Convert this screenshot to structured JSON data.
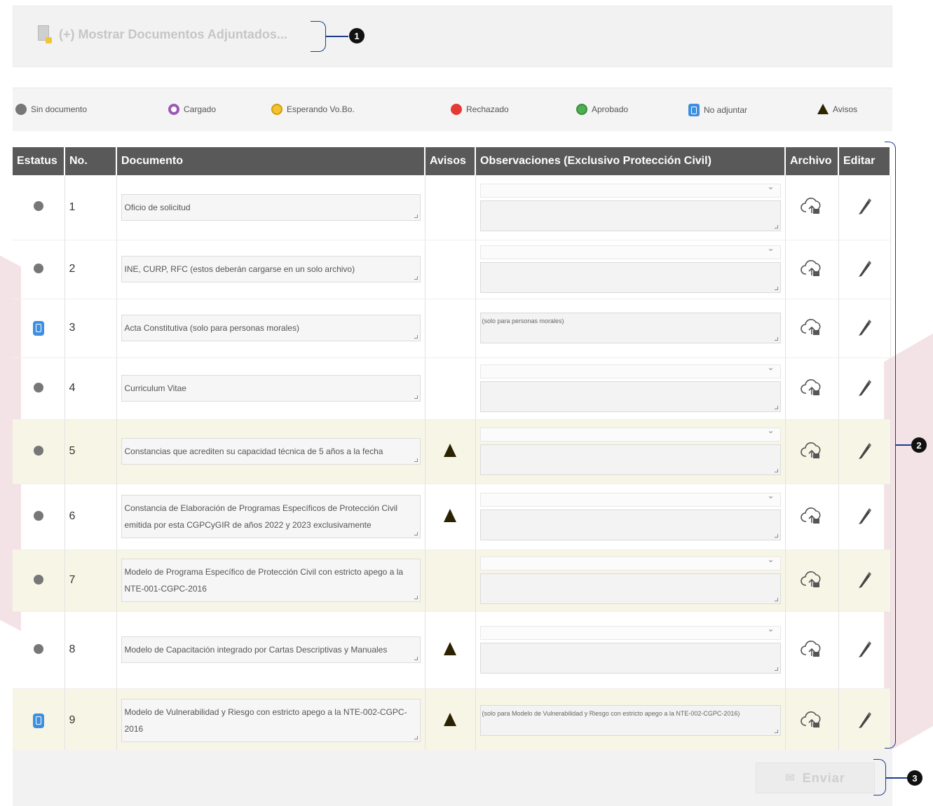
{
  "attachments": {
    "toggle_label": "(+) Mostrar Documentos Adjuntados..."
  },
  "callouts": [
    "1",
    "2",
    "3"
  ],
  "legend": [
    {
      "label": "Sin documento",
      "icon": "gray-dot-icon"
    },
    {
      "label": "Cargado",
      "icon": "purple-ring-icon"
    },
    {
      "label": "Esperando Vo.Bo.",
      "icon": "yellow-dot-icon"
    },
    {
      "label": "Rechazado",
      "icon": "red-dot-icon"
    },
    {
      "label": "Aprobado",
      "icon": "green-check-icon"
    },
    {
      "label": "No adjuntar",
      "icon": "blue-doc-icon"
    },
    {
      "label": "Avisos",
      "icon": "warning-icon"
    }
  ],
  "table": {
    "headers": [
      "Estatus",
      "No.",
      "Documento",
      "Avisos",
      "Observaciones (Exclusivo Protección Civil)",
      "Archivo",
      "Editar"
    ],
    "rows": [
      {
        "status": "gray",
        "no": "1",
        "doc": "Oficio de solicitud",
        "aviso": false,
        "obs": "",
        "highlight": false
      },
      {
        "status": "gray",
        "no": "2",
        "doc": "INE, CURP, RFC (estos deberán cargarse en un solo archivo)",
        "aviso": false,
        "obs": "",
        "highlight": false
      },
      {
        "status": "blue",
        "no": "3",
        "doc": "Acta Constitutiva (solo para personas morales)",
        "aviso": false,
        "obs": "(solo para personas morales)",
        "highlight": false
      },
      {
        "status": "gray",
        "no": "4",
        "doc": "Curriculum Vitae",
        "aviso": false,
        "obs": "",
        "highlight": false
      },
      {
        "status": "gray",
        "no": "5",
        "doc": "Constancias que acrediten su capacidad técnica de 5 años a la fecha",
        "aviso": true,
        "obs": "",
        "highlight": true
      },
      {
        "status": "gray",
        "no": "6",
        "doc": "Constancia de Elaboración de Programas Específicos de Protección Civil emitida por esta CGPCyGIR de años 2022 y 2023 exclusivamente",
        "aviso": true,
        "obs": "",
        "highlight": false
      },
      {
        "status": "gray",
        "no": "7",
        "doc": "Modelo de Programa Específico de Protección Civil con estricto apego a la NTE-001-CGPC-2016",
        "aviso": false,
        "obs": "",
        "highlight": true
      },
      {
        "status": "gray",
        "no": "8",
        "doc": "Modelo de Capacitación integrado por Cartas Descriptivas y Manuales",
        "aviso": true,
        "obs": "",
        "highlight": false
      },
      {
        "status": "blue",
        "no": "9",
        "doc": "Modelo de Vulnerabilidad y Riesgo con estricto apego a la NTE-002-CGPC-2016",
        "aviso": true,
        "obs": "(solo para Modelo de Vulnerabilidad y Riesgo con estricto apego a la NTE-002-CGPC-2016)",
        "highlight": true
      }
    ]
  },
  "footer": {
    "send_label": "Enviar"
  },
  "colors": {
    "header_bg": "#595959",
    "highlight_row": "#f7f6e6",
    "callout_line": "#1d3c8a"
  }
}
